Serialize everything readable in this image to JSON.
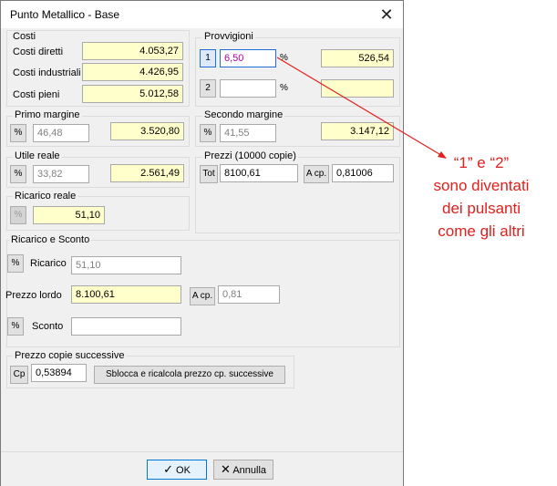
{
  "window": {
    "title": "Punto Metallico - Base"
  },
  "costi": {
    "label": "Costi",
    "rows": [
      {
        "label": "Costi diretti",
        "value": "4.053,27"
      },
      {
        "label": "Costi industriali",
        "value": "4.426,95"
      },
      {
        "label": "Costi pieni",
        "value": "5.012,58"
      }
    ]
  },
  "provvigioni": {
    "label": "Provvigioni",
    "row1": {
      "button": "1",
      "input": "6,50",
      "unit": "%",
      "value": "526,54"
    },
    "row2": {
      "button": "2",
      "input": "",
      "unit": "%",
      "value": ""
    }
  },
  "primo_margine": {
    "label": "Primo margine",
    "button": "%",
    "pct": "46,48",
    "value": "3.520,80"
  },
  "secondo_margine": {
    "label": "Secondo margine",
    "button": "%",
    "pct": "41,55",
    "value": "3.147,12"
  },
  "utile_reale": {
    "label": "Utile reale",
    "button": "%",
    "pct": "33,82",
    "value": "2.561,49"
  },
  "prezzi": {
    "label": "Prezzi (10000 copie)",
    "tot_button": "Tot",
    "tot_value": "8100,61",
    "acp_button": "A cp.",
    "acp_value": "0,81006"
  },
  "ricarico_reale": {
    "label": "Ricarico reale",
    "button": "%",
    "value": "51,10"
  },
  "ricarico_sconto": {
    "label": "Ricarico e Sconto",
    "ricarico_button": "%",
    "ricarico_label": "Ricarico",
    "ricarico_value": "51,10",
    "prezzo_lordo_label": "Prezzo lordo",
    "prezzo_lordo_value": "8.100,61",
    "acp_button": "A cp.",
    "acp_value": "0,81",
    "sconto_button": "%",
    "sconto_label": "Sconto",
    "sconto_value": ""
  },
  "prezzo_copie": {
    "label": "Prezzo copie successive",
    "cp_button": "Cp",
    "value": "0,53894",
    "action_button": "Sblocca e ricalcola prezzo cp. successive"
  },
  "footer": {
    "ok": "OK",
    "cancel": "Annulla"
  },
  "annotation": {
    "line1": "“1” e  “2”",
    "line2": "sono diventati",
    "line3": "dei pulsanti",
    "line4": "come gli altri"
  },
  "colors": {
    "annotation": "#e0201c",
    "field_yellow": "#ffffcc",
    "selected_border": "#1e6fd9"
  }
}
